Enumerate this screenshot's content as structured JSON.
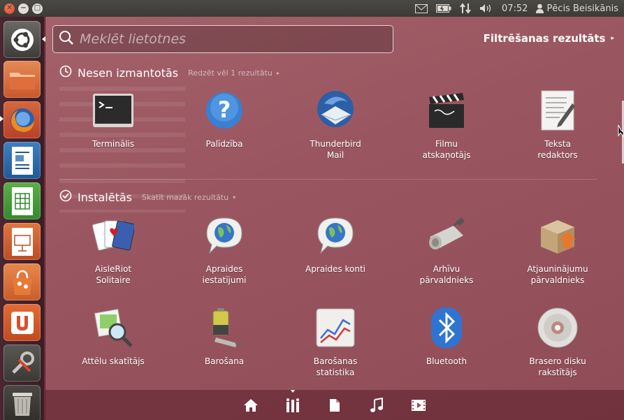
{
  "top_panel": {
    "time": "07:52",
    "user": "Pēcis Beisikānis",
    "icons": [
      "mail-icon",
      "battery-icon",
      "network-icon",
      "volume-icon",
      "user-icon"
    ]
  },
  "window_controls": [
    "close-icon",
    "minimize-icon",
    "maximize-icon"
  ],
  "launcher": {
    "items": [
      "ubuntu-logo-icon",
      "home-folder-icon",
      "firefox-icon",
      "writer-icon",
      "calc-icon",
      "impress-icon",
      "software-center-icon",
      "ubuntu-one-icon",
      "system-settings-icon",
      "trash-icon"
    ]
  },
  "search": {
    "placeholder": "Meklēt lietotnes",
    "value": ""
  },
  "filter": {
    "label": "Filtrēšanas rezultāts"
  },
  "recent": {
    "title": "Nesen izmantotās",
    "more": "Redzēt vēl 1 rezultātu",
    "apps": [
      {
        "label": "Terminālis",
        "icon": "terminal-icon"
      },
      {
        "label": "Palīdzība",
        "icon": "help-icon"
      },
      {
        "label": "Thunderbird\nMail",
        "icon": "thunderbird-icon"
      },
      {
        "label": "Filmu\natskaņotājs",
        "icon": "clapperboard-icon"
      },
      {
        "label": "Teksta\nredaktors",
        "icon": "text-editor-icon"
      }
    ]
  },
  "installed": {
    "title": "Instalētās",
    "more": "Skatīt mazāk rezultātu",
    "apps": [
      {
        "label": "AisleRiot\nSolitaire",
        "icon": "cards-icon"
      },
      {
        "label": "Apraides\niestatījumi",
        "icon": "broadcast-globe-icon"
      },
      {
        "label": "Apraides konti",
        "icon": "broadcast-globe-icon"
      },
      {
        "label": "Arhīvu\npārvaldnieks",
        "icon": "archive-icon"
      },
      {
        "label": "Atjauninājumu\npārvaldnieks",
        "icon": "update-box-icon"
      },
      {
        "label": "Attēlu skatītājs",
        "icon": "image-viewer-icon"
      },
      {
        "label": "Barošana",
        "icon": "power-battery-icon"
      },
      {
        "label": "Barošanas\nstatistika",
        "icon": "power-stats-icon"
      },
      {
        "label": "Bluetooth",
        "icon": "bluetooth-icon"
      },
      {
        "label": "Brasero disku\nrakstītājs",
        "icon": "disc-burner-icon"
      }
    ]
  },
  "lenses": [
    "home-icon",
    "applications-icon",
    "files-icon",
    "music-icon",
    "video-icon"
  ],
  "active_lens": "applications-icon",
  "colors": {
    "dash_bg": "#9a5660",
    "launcher_bg": "#3b1d26",
    "panel_bg": "#3c3b37",
    "close_button": "#e2572f"
  }
}
